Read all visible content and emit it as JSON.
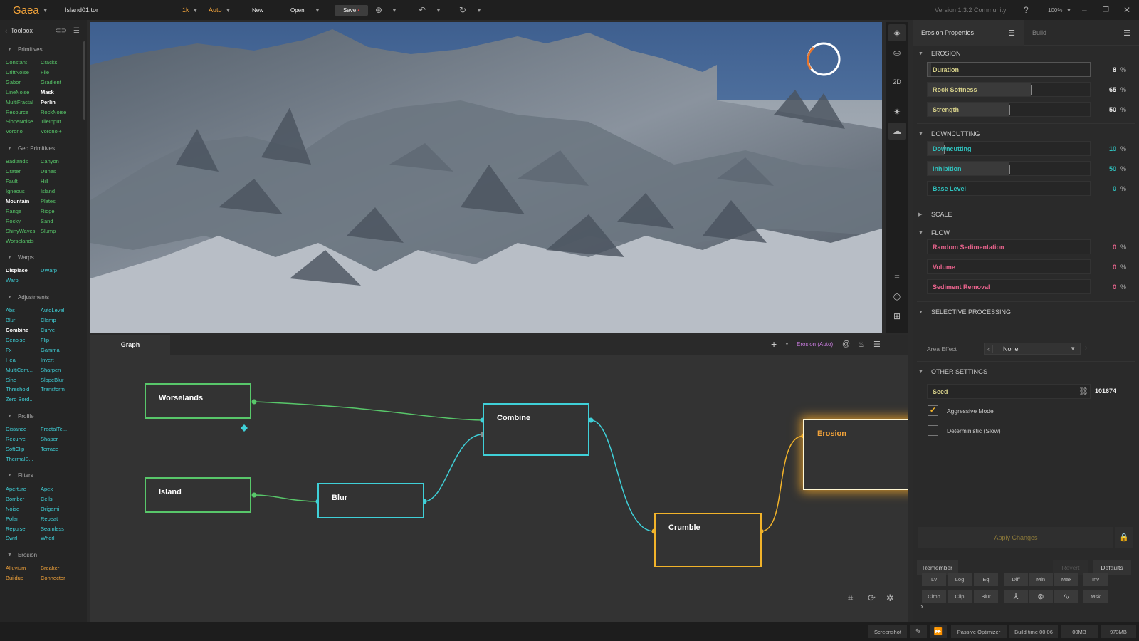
{
  "topbar": {
    "logo": "Gaea",
    "filename": "Island01.tor",
    "resolution": "1k",
    "mode": "Auto",
    "new_label": "New",
    "open_label": "Open",
    "save_label": "Save",
    "version": "Version 1.3.2 Community",
    "zoom": "100%"
  },
  "toolbox": {
    "title": "Toolbox",
    "sections": [
      {
        "name": "Primitives",
        "items": [
          {
            "label": "Constant",
            "color": "green"
          },
          {
            "label": "Cracks",
            "color": "green"
          },
          {
            "label": "DriftNoise",
            "color": "green"
          },
          {
            "label": "File",
            "color": "green"
          },
          {
            "label": "Gabor",
            "color": "green"
          },
          {
            "label": "Gradient",
            "color": "green"
          },
          {
            "label": "LineNoise",
            "color": "green"
          },
          {
            "label": "Mask",
            "color": "white"
          },
          {
            "label": "MultiFractal",
            "color": "green"
          },
          {
            "label": "Perlin",
            "color": "white"
          },
          {
            "label": "Resource",
            "color": "green"
          },
          {
            "label": "RockNoise",
            "color": "green"
          },
          {
            "label": "SlopeNoise",
            "color": "green"
          },
          {
            "label": "TileInput",
            "color": "green"
          },
          {
            "label": "Voronoi",
            "color": "green"
          },
          {
            "label": "Voronoi+",
            "color": "green"
          }
        ]
      },
      {
        "name": "Geo Primitives",
        "items": [
          {
            "label": "Badlands",
            "color": "green"
          },
          {
            "label": "Canyon",
            "color": "green"
          },
          {
            "label": "Crater",
            "color": "green"
          },
          {
            "label": "Dunes",
            "color": "green"
          },
          {
            "label": "Fault",
            "color": "green"
          },
          {
            "label": "Hill",
            "color": "green"
          },
          {
            "label": "Igneous",
            "color": "green"
          },
          {
            "label": "Island",
            "color": "green"
          },
          {
            "label": "Mountain",
            "color": "white"
          },
          {
            "label": "Plates",
            "color": "green"
          },
          {
            "label": "Range",
            "color": "green"
          },
          {
            "label": "Ridge",
            "color": "green"
          },
          {
            "label": "Rocky",
            "color": "green"
          },
          {
            "label": "Sand",
            "color": "green"
          },
          {
            "label": "ShinyWaves",
            "color": "green"
          },
          {
            "label": "Slump",
            "color": "green"
          },
          {
            "label": "Worselands",
            "color": "green"
          }
        ]
      },
      {
        "name": "Warps",
        "items": [
          {
            "label": "Displace",
            "color": "white"
          },
          {
            "label": "DWarp",
            "color": "cyan"
          },
          {
            "label": "Warp",
            "color": "cyan"
          }
        ]
      },
      {
        "name": "Adjustments",
        "items": [
          {
            "label": "Abs",
            "color": "cyan"
          },
          {
            "label": "AutoLevel",
            "color": "cyan"
          },
          {
            "label": "Blur",
            "color": "cyan"
          },
          {
            "label": "Clamp",
            "color": "cyan"
          },
          {
            "label": "Combine",
            "color": "white"
          },
          {
            "label": "Curve",
            "color": "cyan"
          },
          {
            "label": "Denoise",
            "color": "cyan"
          },
          {
            "label": "Flip",
            "color": "cyan"
          },
          {
            "label": "Fx",
            "color": "cyan"
          },
          {
            "label": "Gamma",
            "color": "cyan"
          },
          {
            "label": "Heal",
            "color": "cyan"
          },
          {
            "label": "Invert",
            "color": "cyan"
          },
          {
            "label": "MultiCom...",
            "color": "cyan"
          },
          {
            "label": "Sharpen",
            "color": "cyan"
          },
          {
            "label": "Sine",
            "color": "cyan"
          },
          {
            "label": "SlopeBlur",
            "color": "cyan"
          },
          {
            "label": "Threshold",
            "color": "cyan"
          },
          {
            "label": "Transform",
            "color": "cyan"
          },
          {
            "label": "Zero Bord...",
            "color": "cyan"
          }
        ]
      },
      {
        "name": "Profile",
        "items": [
          {
            "label": "Distance",
            "color": "cyan"
          },
          {
            "label": "FractalTe...",
            "color": "cyan"
          },
          {
            "label": "Recurve",
            "color": "cyan"
          },
          {
            "label": "Shaper",
            "color": "cyan"
          },
          {
            "label": "SoftClip",
            "color": "cyan"
          },
          {
            "label": "Terrace",
            "color": "cyan"
          },
          {
            "label": "ThermalS...",
            "color": "cyan"
          }
        ]
      },
      {
        "name": "Filters",
        "items": [
          {
            "label": "Aperture",
            "color": "cyan"
          },
          {
            "label": "Apex",
            "color": "cyan"
          },
          {
            "label": "Bomber",
            "color": "cyan"
          },
          {
            "label": "Cells",
            "color": "cyan"
          },
          {
            "label": "Noise",
            "color": "cyan"
          },
          {
            "label": "Origami",
            "color": "cyan"
          },
          {
            "label": "Polar",
            "color": "cyan"
          },
          {
            "label": "Repeat",
            "color": "cyan"
          },
          {
            "label": "Repulse",
            "color": "cyan"
          },
          {
            "label": "Seamless",
            "color": "cyan"
          },
          {
            "label": "Swirl",
            "color": "cyan"
          },
          {
            "label": "Whorl",
            "color": "cyan"
          }
        ]
      },
      {
        "name": "Erosion",
        "items": [
          {
            "label": "Alluvium",
            "color": "orange"
          },
          {
            "label": "Breaker",
            "color": "orange"
          },
          {
            "label": "Buildup",
            "color": "orange"
          },
          {
            "label": "Connector",
            "color": "orange"
          }
        ]
      }
    ]
  },
  "viewport": {
    "mode_2d": "2D"
  },
  "graph": {
    "tab": "Graph",
    "active_node": "Erosion (Auto)",
    "nodes": {
      "worselands": "Worselands",
      "island": "Island",
      "blur": "Blur",
      "combine": "Combine",
      "crumble": "Crumble",
      "erosion": "Erosion"
    }
  },
  "properties": {
    "tab": "Erosion Properties",
    "build_tab": "Build",
    "sections": {
      "erosion": "EROSION",
      "downcutting": "DOWNCUTTING",
      "scale": "SCALE",
      "flow": "FLOW",
      "selective": "SELECTIVE PROCESSING",
      "other": "OTHER SETTINGS"
    },
    "erosion": [
      {
        "label": "Duration",
        "value": "8",
        "fill": 0.02
      },
      {
        "label": "Rock Softness",
        "value": "65",
        "fill": 0.63
      },
      {
        "label": "Strength",
        "value": "50",
        "fill": 0.5
      }
    ],
    "downcutting": [
      {
        "label": "Downcutting",
        "value": "10",
        "fill": 0.1
      },
      {
        "label": "Inhibition",
        "value": "50",
        "fill": 0.5
      },
      {
        "label": "Base Level",
        "value": "0",
        "fill": 0
      }
    ],
    "flow": [
      {
        "label": "Random Sedimentation",
        "value": "0",
        "fill": 0
      },
      {
        "label": "Volume",
        "value": "0",
        "fill": 0
      },
      {
        "label": "Sediment Removal",
        "value": "0",
        "fill": 0
      }
    ],
    "percent": "%",
    "area_effect_label": "Area Effect",
    "area_effect_value": "None",
    "seed_label": "Seed",
    "seed_value": "101674",
    "aggressive_mode": "Aggressive Mode",
    "aggressive_checked": true,
    "deterministic": "Deterministic (Slow)",
    "deterministic_checked": false,
    "apply_changes": "Apply Changes",
    "remember": "Remember",
    "revert": "Revert",
    "defaults": "Defaults",
    "quick_row1": [
      "Lv",
      "Log",
      "Eq",
      "Diff",
      "Min",
      "Max",
      "Inv"
    ],
    "quick_row2": [
      "Clmp",
      "Clip",
      "Blur"
    ],
    "quick_row2_icons": [
      "fork-icon",
      "circle-x-icon",
      "wave-icon"
    ],
    "quick_row2_last": "Msk"
  },
  "status": {
    "screenshot": "Screenshot",
    "optimizer": "Passive Optimizer",
    "build_time": "Build time 00:06",
    "mem1": "00MB",
    "mem2": "973MB"
  },
  "colors": {
    "accent_orange": "#f2a33a",
    "node_green": "#58c76a",
    "node_cyan": "#3fd0d8",
    "node_yellow": "#f2b32a"
  }
}
